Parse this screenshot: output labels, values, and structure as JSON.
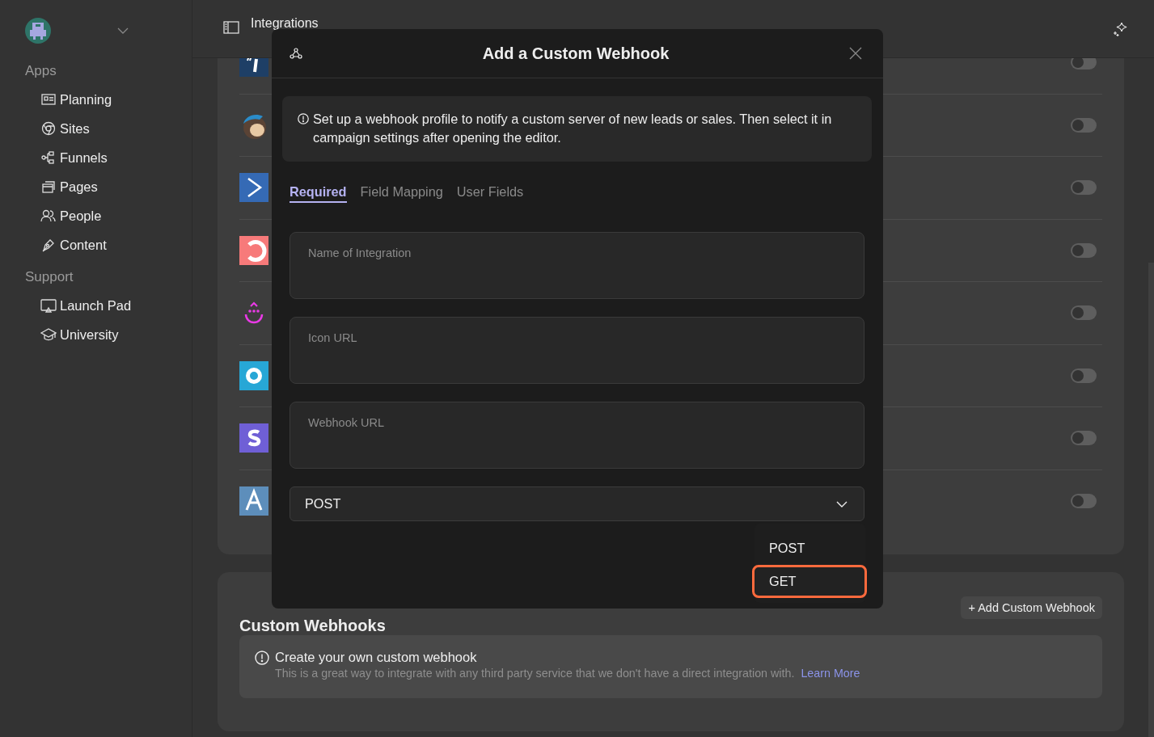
{
  "sidebar": {
    "sections": [
      {
        "title": "Apps",
        "items": [
          {
            "label": "Planning"
          },
          {
            "label": "Sites"
          },
          {
            "label": "Funnels"
          },
          {
            "label": "Pages"
          },
          {
            "label": "People"
          },
          {
            "label": "Content"
          }
        ]
      },
      {
        "title": "Support",
        "items": [
          {
            "label": "Launch Pad"
          },
          {
            "label": "University"
          }
        ]
      }
    ]
  },
  "header": {
    "title": "Integrations"
  },
  "integrations": [
    {
      "on": false
    },
    {
      "on": false
    },
    {
      "on": false
    },
    {
      "on": false
    },
    {
      "on": false
    },
    {
      "on": false
    },
    {
      "on": false
    },
    {
      "on": false
    }
  ],
  "custom_webhooks": {
    "title": "Custom Webhooks",
    "add_button": "+ Add Custom Webhook",
    "notice_title": "Create your own custom webhook",
    "notice_text": "This is a great way to integrate with any third party service that we don't have a direct integration with.",
    "link": "Learn More"
  },
  "dialog": {
    "title": "Add a Custom Webhook",
    "info": "Set up a webhook profile to notify a custom server of new leads or sales. Then select it in campaign settings after opening the editor.",
    "tabs": [
      {
        "label": "Required",
        "selected": true
      },
      {
        "label": "Field Mapping",
        "selected": false
      },
      {
        "label": "User Fields",
        "selected": false
      }
    ],
    "fields": [
      {
        "placeholder": "Name of Integration"
      },
      {
        "placeholder": "Icon URL"
      },
      {
        "placeholder": "Webhook URL"
      }
    ],
    "method": {
      "value": "POST",
      "expanded": true,
      "options": [
        {
          "label": "POST",
          "highlighted": false
        },
        {
          "label": "GET",
          "highlighted": true
        }
      ]
    }
  }
}
